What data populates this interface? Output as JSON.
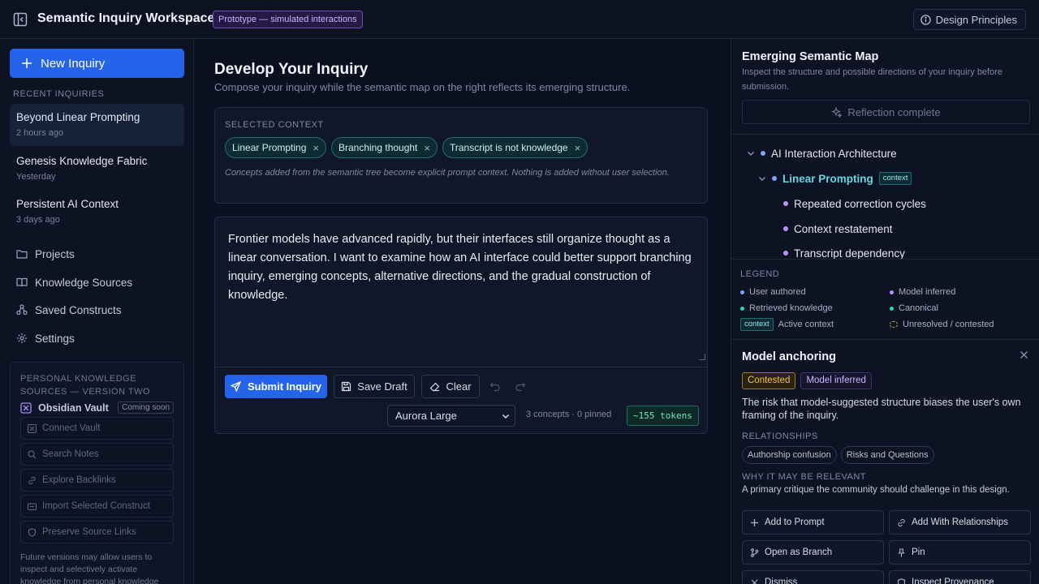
{
  "topbar": {
    "title": "Semantic Inquiry Workspace",
    "badge": "Prototype — simulated interactions",
    "design_btn": "Design Principles"
  },
  "sidebar": {
    "new_label": "New Inquiry",
    "recent_heading": "RECENT INQUIRIES",
    "recent": [
      {
        "title": "Beyond Linear Prompting",
        "time": "2 hours ago"
      },
      {
        "title": "Genesis Knowledge Fabric",
        "time": "Yesterday"
      },
      {
        "title": "Persistent AI Context",
        "time": "3 days ago"
      }
    ],
    "nav": [
      {
        "label": "Projects",
        "icon": "folder-icon"
      },
      {
        "label": "Knowledge Sources",
        "icon": "book-icon"
      },
      {
        "label": "Saved Constructs",
        "icon": "nodes-icon"
      },
      {
        "label": "Settings",
        "icon": "gear-icon"
      }
    ],
    "pks": {
      "heading": "PERSONAL KNOWLEDGE SOURCES — VERSION TWO",
      "vault_name": "Obsidian Vault",
      "vault_badge": "Coming soon",
      "buttons": [
        "Connect Vault",
        "Search Notes",
        "Explore Backlinks",
        "Import Selected Construct",
        "Preserve Source Links"
      ],
      "note": "Future versions may allow users to inspect and selectively activate knowledge from personal knowledge"
    }
  },
  "main": {
    "title": "Develop Your Inquiry",
    "subtitle": "Compose your inquiry while the semantic map on the right reflects its emerging structure.",
    "context_heading": "SELECTED CONTEXT",
    "chips": [
      "Linear Prompting",
      "Branching thought",
      "Transcript is not knowledge"
    ],
    "context_note": "Concepts added from the semantic tree become explicit prompt context. Nothing is added without user selection.",
    "editor_text": "Frontier models have advanced rapidly, but their interfaces still organize thought as a linear conversation. I want to examine how an AI interface could better support branching inquiry, emerging concepts, alternative directions, and the gradual construction of knowledge.",
    "submit_label": "Submit Inquiry",
    "save_label": "Save Draft",
    "clear_label": "Clear",
    "model_value": "Aurora Large",
    "meta": "3 concepts · 0 pinned",
    "tokens": "~155 tokens"
  },
  "map": {
    "title": "Emerging Semantic Map",
    "subtitle": "Inspect the structure and possible directions of your inquiry before submission.",
    "reflect_label": "Reflection complete",
    "tree": [
      {
        "label": "AI Interaction Architecture"
      },
      {
        "label": "Linear Prompting",
        "tag": "context"
      },
      {
        "label": "Repeated correction cycles"
      },
      {
        "label": "Context restatement"
      },
      {
        "label": "Transcript dependency"
      }
    ],
    "legend_heading": "LEGEND",
    "legend": {
      "user": "User authored",
      "model": "Model inferred",
      "retrieved": "Retrieved knowledge",
      "canonical": "Canonical",
      "context_tag": "context",
      "active": "Active context",
      "unresolved": "Unresolved / contested"
    },
    "colors": {
      "user": "#7aa2f7",
      "model": "#b794f6",
      "retrieved": "#2dd4bf",
      "canonical": "#34d399",
      "contested": "#f2c14e"
    }
  },
  "detail": {
    "title": "Model anchoring",
    "tags": [
      "Contested",
      "Model inferred"
    ],
    "description": "The risk that model-suggested structure biases the user's own framing of the inquiry.",
    "relationships_heading": "RELATIONSHIPS",
    "relationships": [
      "Authorship confusion",
      "Risks and Questions"
    ],
    "why_heading": "WHY IT MAY BE RELEVANT",
    "why_text": "A primary critique the community should challenge in this design.",
    "actions": [
      "Add to Prompt",
      "Add With Relationships",
      "Open as Branch",
      "Pin",
      "Dismiss",
      "Inspect Provenance"
    ]
  }
}
